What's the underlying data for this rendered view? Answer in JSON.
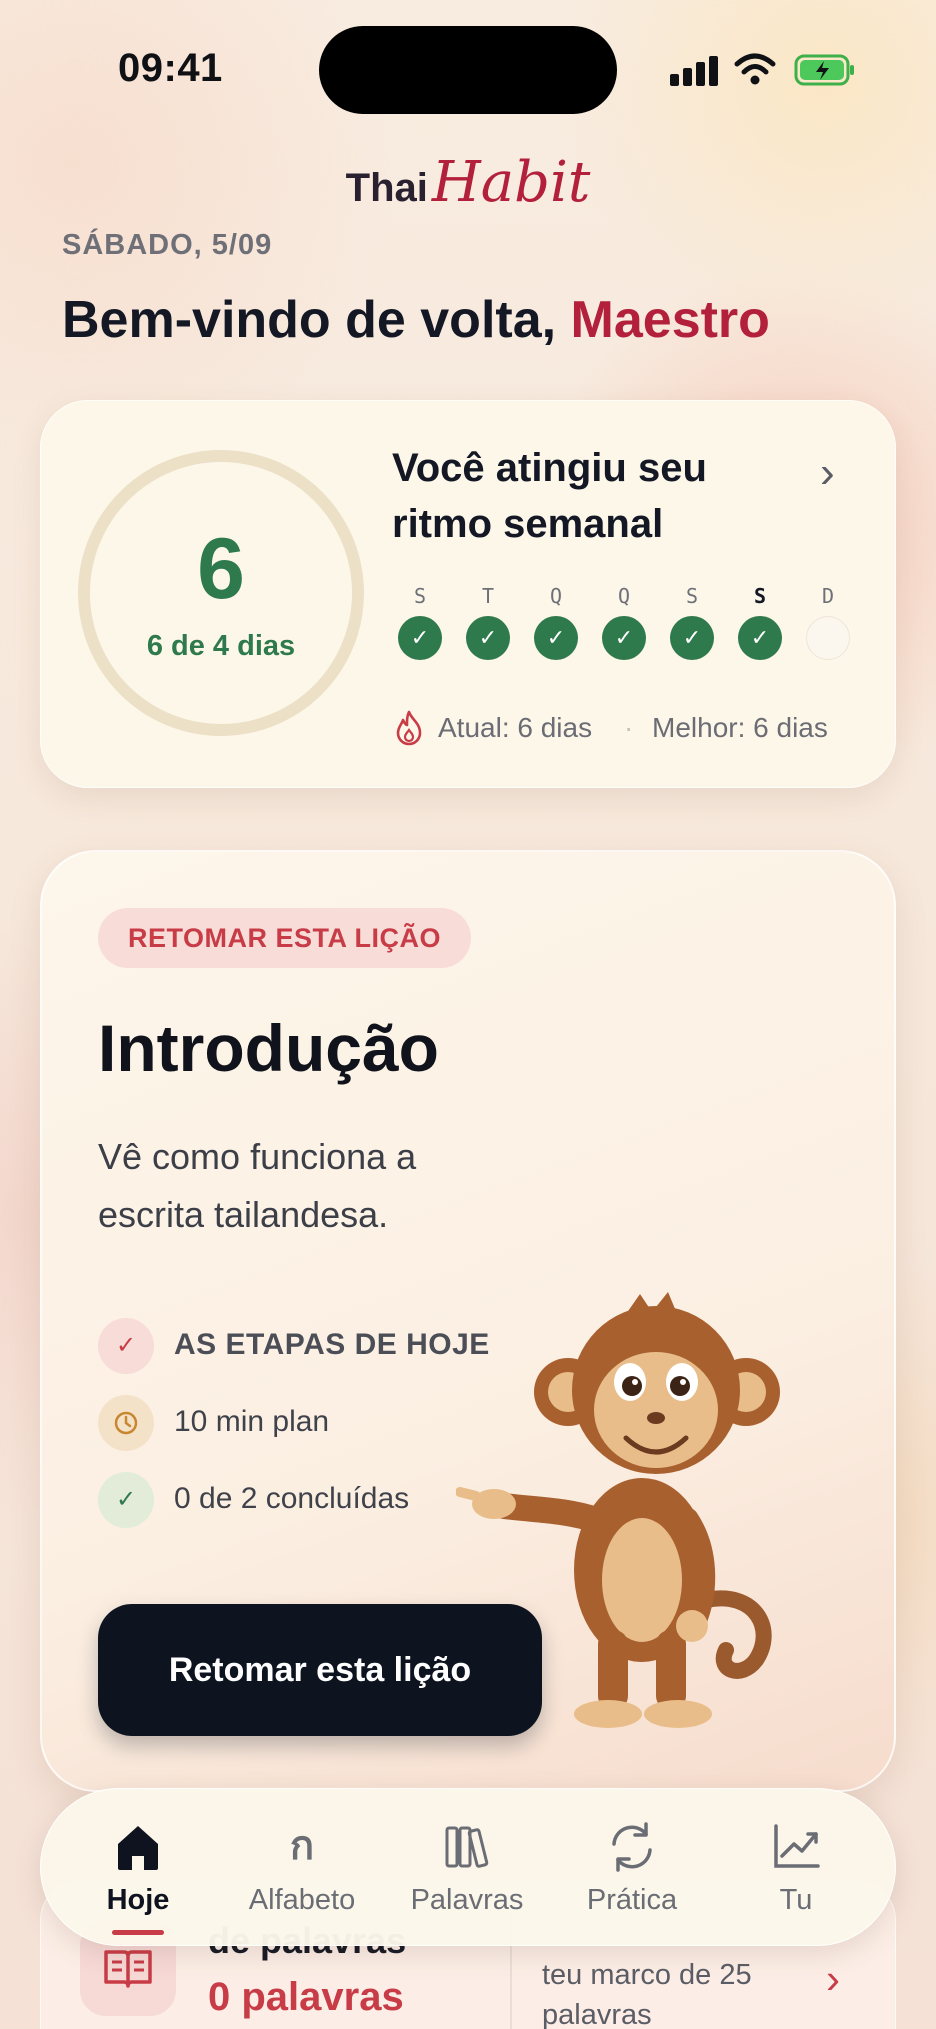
{
  "status_bar": {
    "time": "09:41"
  },
  "logo": {
    "part1": "Thai",
    "part2": "Habit"
  },
  "header": {
    "date": "SÁBADO, 5/09",
    "welcome_prefix": "Bem-vindo de volta, ",
    "user_name": "Maestro"
  },
  "streak": {
    "count": "6",
    "subtitle": "6 de 4 dias",
    "title": "Você atingiu seu ritmo semanal",
    "days": [
      {
        "label": "S",
        "done": true,
        "today": false
      },
      {
        "label": "T",
        "done": true,
        "today": false
      },
      {
        "label": "Q",
        "done": true,
        "today": false
      },
      {
        "label": "Q",
        "done": true,
        "today": false
      },
      {
        "label": "S",
        "done": true,
        "today": false
      },
      {
        "label": "S",
        "done": true,
        "today": true
      },
      {
        "label": "D",
        "done": false,
        "today": false
      }
    ],
    "current": "Atual: 6 dias",
    "separator": "·",
    "best": "Melhor: 6 dias"
  },
  "lesson": {
    "badge": "RETOMAR ESTA LIÇÃO",
    "title": "Introdução",
    "description": "Vê como funciona a escrita tailandesa.",
    "steps": [
      {
        "icon": "check-icon",
        "label": "AS ETAPAS DE HOJE"
      },
      {
        "icon": "clock-icon",
        "label": "10 min plan"
      },
      {
        "icon": "check-icon",
        "label": "0 de 2 concluídas"
      }
    ],
    "button_label": "Retomar esta lição"
  },
  "words_card": {
    "heading": "de palavras",
    "count": "0 palavras",
    "milestone": "teu marco de 25 palavras"
  },
  "tabs": [
    {
      "label": "Hoje",
      "icon": "home-icon",
      "active": true
    },
    {
      "label": "Alfabeto",
      "icon": "thai-letter-icon",
      "glyph": "ก",
      "active": false
    },
    {
      "label": "Palavras",
      "icon": "books-icon",
      "active": false
    },
    {
      "label": "Prática",
      "icon": "refresh-icon",
      "active": false
    },
    {
      "label": "Tu",
      "icon": "chart-icon",
      "active": false
    }
  ],
  "colors": {
    "brand_red": "#b3203b",
    "accent_red": "#c83c47",
    "success_green": "#2f7a4d",
    "dark_button": "#0d1420",
    "card_bg": "#fdf7ea"
  }
}
